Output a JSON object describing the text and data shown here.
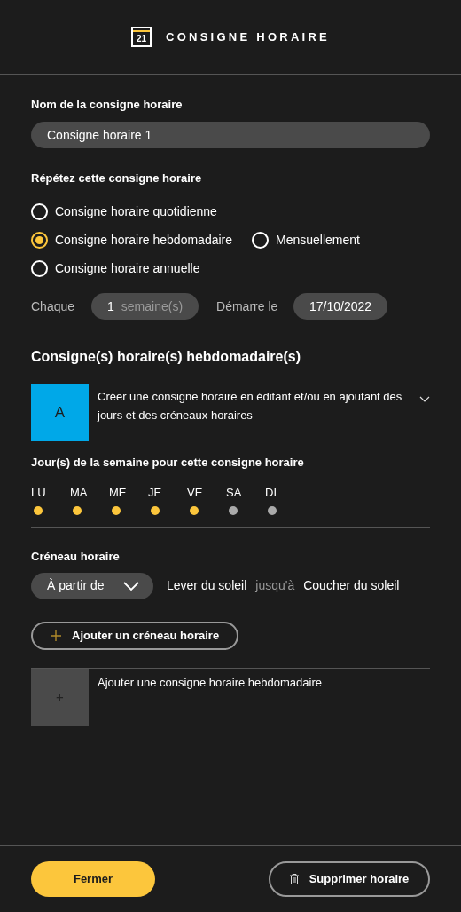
{
  "header": {
    "icon_text": "21",
    "title": "CONSIGNE HORAIRE"
  },
  "name_field": {
    "label": "Nom de la consigne horaire",
    "value": "Consigne horaire 1"
  },
  "repeat": {
    "label": "Répétez cette consigne horaire",
    "rows": [
      [
        {
          "label": "Consigne horaire quotidienne",
          "selected": false
        }
      ],
      [
        {
          "label": "Consigne horaire hebdomadaire",
          "selected": true
        },
        {
          "label": "Mensuellement",
          "selected": false
        }
      ],
      [
        {
          "label": "Consigne horaire annuelle",
          "selected": false
        }
      ]
    ]
  },
  "every": {
    "label": "Chaque",
    "value": "1",
    "unit": "semaine(s)",
    "start_label": "Démarre le",
    "start_value": "17/10/2022"
  },
  "weekly": {
    "heading": "Consigne(s) horaire(s) hebdomadaire(s)",
    "schedule": {
      "letter": "A",
      "color": "#00a8e8",
      "description": "Créer une consigne horaire en éditant et/ou en ajoutant des jours et des créneaux horaires",
      "expanded": true
    },
    "days_label": "Jour(s) de la semaine pour cette consigne horaire",
    "days": [
      {
        "label": "LU",
        "selected": true
      },
      {
        "label": "MA",
        "selected": true
      },
      {
        "label": "ME",
        "selected": true
      },
      {
        "label": "JE",
        "selected": true
      },
      {
        "label": "VE",
        "selected": true
      },
      {
        "label": "SA",
        "selected": false
      },
      {
        "label": "DI",
        "selected": false
      }
    ],
    "slot": {
      "label": "Créneau horaire",
      "mode": "À partir de",
      "from": "Lever du soleil",
      "joiner": "jusqu'à",
      "to": "Coucher du soleil"
    },
    "add_slot": "Ajouter un créneau horaire",
    "add_schedule": {
      "icon_text": "+",
      "label": "Ajouter une consigne horaire hebdomadaire"
    }
  },
  "footer": {
    "close": "Fermer",
    "delete": "Supprimer horaire"
  }
}
